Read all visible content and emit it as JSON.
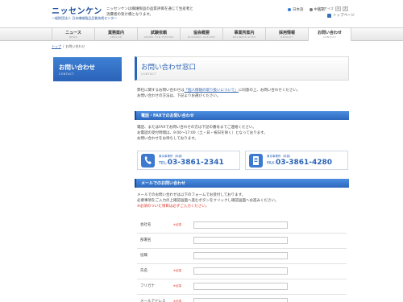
{
  "header": {
    "logo_main": "ニッセンケン",
    "logo_sub": "一般財団法人 日本繊維製品品質技術センター",
    "tagline": "ニッセンケンは繊維製品の品質評価を通じて生産者と消費者の架け橋となります。",
    "lang_ja": "日本語",
    "lang_other": "中国語",
    "font_size_label": "文字サイズ",
    "font_small": "小",
    "font_large": "大",
    "top_link": "トップページ"
  },
  "nav": [
    {
      "jp": "ニュース",
      "en": "NEWS"
    },
    {
      "jp": "業務案内",
      "en": "SERVICE"
    },
    {
      "jp": "試験依頼",
      "en": "ORDER FOR TESTING"
    },
    {
      "jp": "協会概要",
      "en": "BUSINESS OUTLINE"
    },
    {
      "jp": "事業所案内",
      "en": "BUSINESS SITES"
    },
    {
      "jp": "採用情報",
      "en": "RECRUIT"
    },
    {
      "jp": "お問い合わせ",
      "en": "CONTACT"
    }
  ],
  "breadcrumb": {
    "home": "トップ",
    "sep": " / ",
    "current": "お問い合わせ"
  },
  "sidebar": {
    "title": "お問い合わせ",
    "en": "CONTACT"
  },
  "main": {
    "title": "お問い合わせ窓口",
    "title_en": "CONTACT",
    "intro_1a": "弊社に関するお問い合わせは",
    "intro_link": "「個人情報の取り扱いについて」",
    "intro_1b": "に同意の上、お問い合わせください。",
    "intro_2": "お問い合わせの方法は、下記よりお選びください。"
  },
  "phone_section": {
    "heading": "電話・FAXでのお問い合わせ",
    "line_1": "電話、またはFAXでお問い合わせの方は下記の番号までご連絡ください。",
    "line_2": "お電話の受付時間は、9:00〜17:00（土・日・祝日を除く）となっております。",
    "line_3": "お問い合わせをお待ちしております。",
    "tel_office": "東京事業所（本部）",
    "tel_prefix": "TEL:",
    "tel_number": "03-3861-2341",
    "fax_office": "東京事業所（本部）",
    "fax_prefix": "FAX:",
    "fax_number": "03-3861-4280"
  },
  "mail_section": {
    "heading": "メールでのお問い合わせ",
    "line_1": "メールでのお問い合わせは以下のフォームでお受付しております。",
    "line_2": "必要事項をご入力の上確認画面へ進むボタンをクリックし確認画面へお進みください。",
    "line_3": "※必須のついた項目は必ずご入力ください。"
  },
  "form": {
    "required_label": "※必須",
    "fields": [
      {
        "label": "会社名",
        "required": true
      },
      {
        "label": "部署名",
        "required": false
      },
      {
        "label": "役職",
        "required": false
      },
      {
        "label": "氏名",
        "required": true
      },
      {
        "label": "フリガナ",
        "required": true
      },
      {
        "label": "メールアドレス",
        "required": true
      }
    ]
  },
  "colors": {
    "accent": "#2a63b8",
    "required": "#d9362b"
  }
}
